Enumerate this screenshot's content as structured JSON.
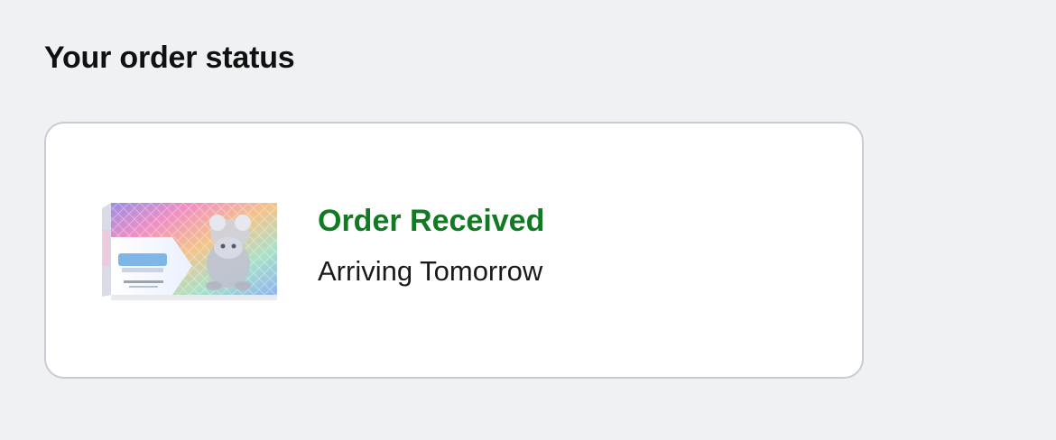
{
  "section": {
    "title": "Your order status"
  },
  "order": {
    "status": "Order Received",
    "arrival": "Arriving Tomorrow",
    "status_color": "#127a22",
    "product_image_icon": "trading-card-box-image"
  }
}
